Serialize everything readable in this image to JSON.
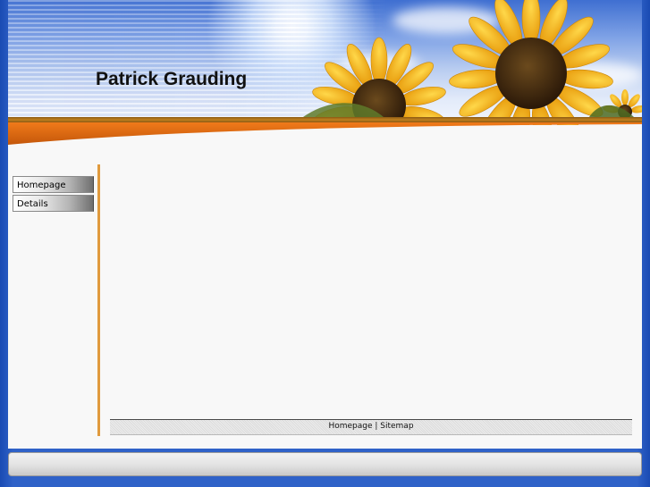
{
  "header": {
    "site_title": "Patrick Grauding"
  },
  "nav": {
    "items": [
      {
        "label": "Homepage"
      },
      {
        "label": "Details"
      }
    ]
  },
  "footer": {
    "links": [
      {
        "label": "Homepage"
      },
      {
        "label": "Sitemap"
      }
    ],
    "separator": " | "
  },
  "colors": {
    "accent": "#e09a3e",
    "header_sky": "#7fa2e6",
    "sunflower_petal": "#f2b21a",
    "sunflower_center": "#3a2510"
  },
  "icons": [
    "sun-glare-icon",
    "sunflower-icon"
  ]
}
